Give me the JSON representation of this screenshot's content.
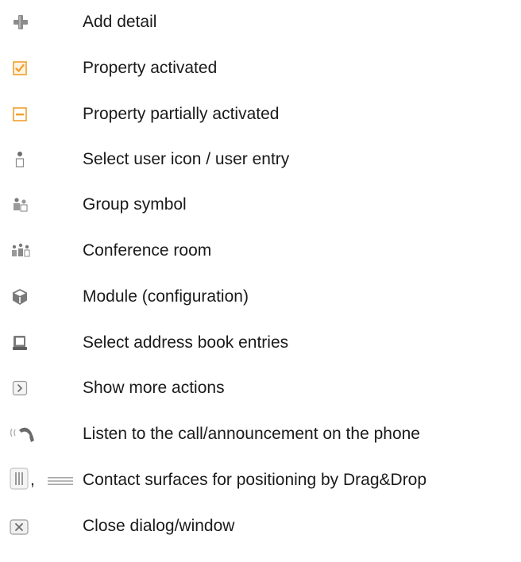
{
  "legend": {
    "items": [
      {
        "icon": "plus-icon",
        "label": "Add detail"
      },
      {
        "icon": "checkbox-checked-icon",
        "label": "Property activated"
      },
      {
        "icon": "checkbox-partial-icon",
        "label": "Property partially activated"
      },
      {
        "icon": "user-icon",
        "label": "Select user icon / user entry"
      },
      {
        "icon": "group-icon",
        "label": "Group symbol"
      },
      {
        "icon": "conference-room-icon",
        "label": "Conference room"
      },
      {
        "icon": "module-icon",
        "label": "Module (configuration)"
      },
      {
        "icon": "address-book-icon",
        "label": "Select address book entries"
      },
      {
        "icon": "more-actions-icon",
        "label": "Show more actions"
      },
      {
        "icon": "phone-listen-icon",
        "label": "Listen to the call/announcement on the phone"
      },
      {
        "icon": "drag-handle-icon",
        "label": "Contact surfaces for positioning by Drag&Drop",
        "separator": ","
      },
      {
        "icon": "close-icon",
        "label": "Close dialog/window"
      }
    ]
  },
  "colors": {
    "accent_orange": "#f0a030",
    "icon_gray": "#8a8a8a"
  }
}
